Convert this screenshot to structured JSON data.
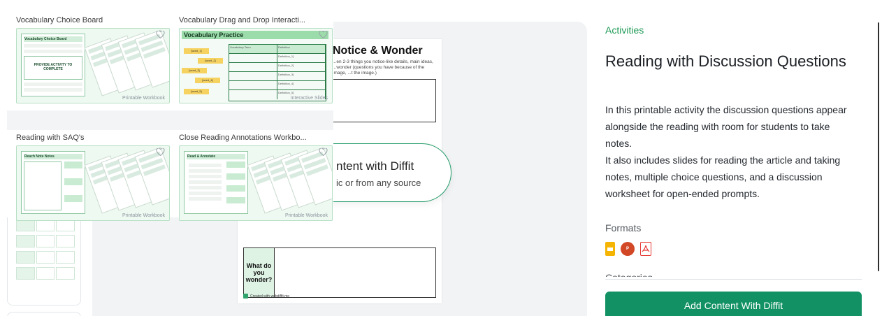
{
  "templates": [
    {
      "title": "Vocabulary Choice Board",
      "kind": "Printable Workbook",
      "doc_heading": "Vocabulary Choice Board",
      "center_text": "PROVIDE ACTIVITY TO COMPLETE"
    },
    {
      "title": "Vocabulary Drag and Drop Interacti...",
      "kind": "Interactive Slides",
      "doc_heading": "Vocabulary Practice",
      "table_headers": [
        "Vocabulary Term",
        "Definition"
      ],
      "definition_rows": [
        "Definition_1]",
        "Definition_2]",
        "Definition_3]",
        "Definition_4]",
        "Definition_5]"
      ],
      "chips": [
        "[word_1]",
        "[word_2]",
        "[word_3]",
        "[word_4]",
        "[word_5]"
      ]
    },
    {
      "title": "Reading with SAQ's",
      "kind": "Printable Workbook",
      "doc_heading": "Reach Note Notes"
    },
    {
      "title": "Close Reading Annotations Workbo...",
      "kind": "Printable Workbook",
      "doc_heading": "Read & Annotate"
    }
  ],
  "preview": {
    "sheet_title": "Notice & Wonder",
    "sheet_subtitle": "...en 2-3 things you notice-like details, main ideas, ...wonder (questions you have because of the image, ...t the image.)",
    "wonder_label": "What do you wonder?",
    "footer": "Created with webdiffit.me",
    "cta_title": "ntent with Diffit",
    "cta_subtitle": "ic or from any source"
  },
  "details": {
    "eyebrow": "Activities",
    "title": "Reading with Discussion Questions",
    "description_1": "In this printable activity the discussion questions appear alongside the reading with room for students to take notes.",
    "description_2": "It also includes slides for reading the article and taking notes, multiple choice questions, and a discussion worksheet for open-ended prompts.",
    "formats_label": "Formats",
    "formats": [
      {
        "icon": "google-slides-icon",
        "color": "#f4b400"
      },
      {
        "icon": "powerpoint-icon",
        "color": "#d24726",
        "glyph": "P"
      },
      {
        "icon": "pdf-icon",
        "color": "#e53935"
      }
    ],
    "categories_label": "Categories",
    "primary_button": "Add Content With Diffit"
  },
  "colors": {
    "accent": "#119164",
    "eyebrow": "#1f9a57"
  }
}
